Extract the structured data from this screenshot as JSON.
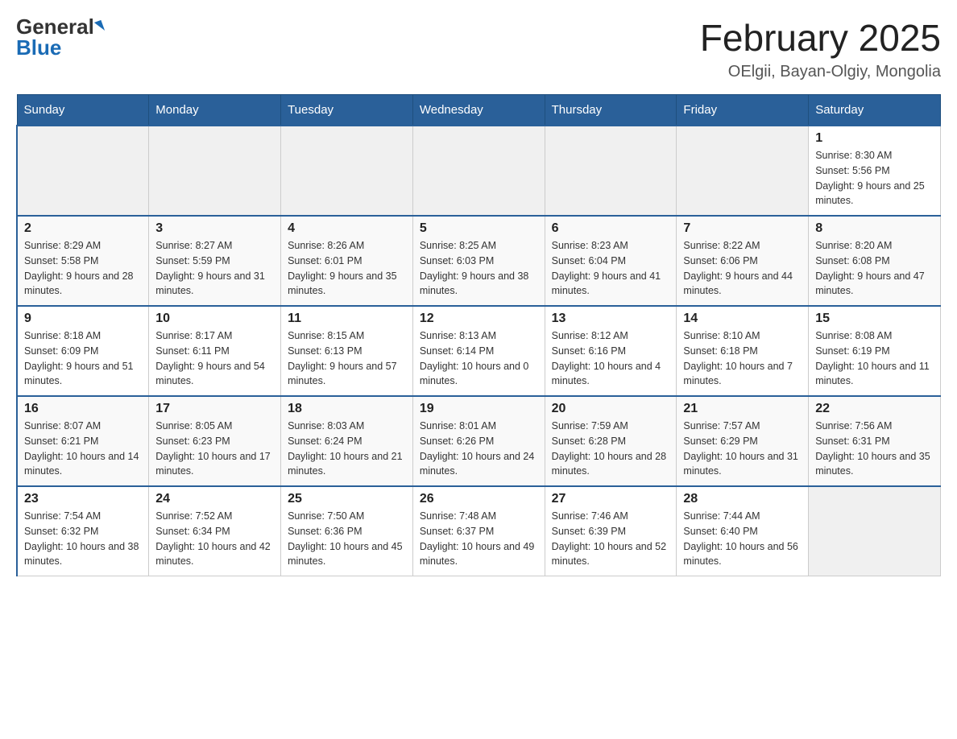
{
  "header": {
    "logo_general": "General",
    "logo_blue": "Blue",
    "title": "February 2025",
    "location": "OElgii, Bayan-Olgiy, Mongolia"
  },
  "weekdays": [
    "Sunday",
    "Monday",
    "Tuesday",
    "Wednesday",
    "Thursday",
    "Friday",
    "Saturday"
  ],
  "weeks": [
    [
      {
        "day": "",
        "info": ""
      },
      {
        "day": "",
        "info": ""
      },
      {
        "day": "",
        "info": ""
      },
      {
        "day": "",
        "info": ""
      },
      {
        "day": "",
        "info": ""
      },
      {
        "day": "",
        "info": ""
      },
      {
        "day": "1",
        "info": "Sunrise: 8:30 AM\nSunset: 5:56 PM\nDaylight: 9 hours and 25 minutes."
      }
    ],
    [
      {
        "day": "2",
        "info": "Sunrise: 8:29 AM\nSunset: 5:58 PM\nDaylight: 9 hours and 28 minutes."
      },
      {
        "day": "3",
        "info": "Sunrise: 8:27 AM\nSunset: 5:59 PM\nDaylight: 9 hours and 31 minutes."
      },
      {
        "day": "4",
        "info": "Sunrise: 8:26 AM\nSunset: 6:01 PM\nDaylight: 9 hours and 35 minutes."
      },
      {
        "day": "5",
        "info": "Sunrise: 8:25 AM\nSunset: 6:03 PM\nDaylight: 9 hours and 38 minutes."
      },
      {
        "day": "6",
        "info": "Sunrise: 8:23 AM\nSunset: 6:04 PM\nDaylight: 9 hours and 41 minutes."
      },
      {
        "day": "7",
        "info": "Sunrise: 8:22 AM\nSunset: 6:06 PM\nDaylight: 9 hours and 44 minutes."
      },
      {
        "day": "8",
        "info": "Sunrise: 8:20 AM\nSunset: 6:08 PM\nDaylight: 9 hours and 47 minutes."
      }
    ],
    [
      {
        "day": "9",
        "info": "Sunrise: 8:18 AM\nSunset: 6:09 PM\nDaylight: 9 hours and 51 minutes."
      },
      {
        "day": "10",
        "info": "Sunrise: 8:17 AM\nSunset: 6:11 PM\nDaylight: 9 hours and 54 minutes."
      },
      {
        "day": "11",
        "info": "Sunrise: 8:15 AM\nSunset: 6:13 PM\nDaylight: 9 hours and 57 minutes."
      },
      {
        "day": "12",
        "info": "Sunrise: 8:13 AM\nSunset: 6:14 PM\nDaylight: 10 hours and 0 minutes."
      },
      {
        "day": "13",
        "info": "Sunrise: 8:12 AM\nSunset: 6:16 PM\nDaylight: 10 hours and 4 minutes."
      },
      {
        "day": "14",
        "info": "Sunrise: 8:10 AM\nSunset: 6:18 PM\nDaylight: 10 hours and 7 minutes."
      },
      {
        "day": "15",
        "info": "Sunrise: 8:08 AM\nSunset: 6:19 PM\nDaylight: 10 hours and 11 minutes."
      }
    ],
    [
      {
        "day": "16",
        "info": "Sunrise: 8:07 AM\nSunset: 6:21 PM\nDaylight: 10 hours and 14 minutes."
      },
      {
        "day": "17",
        "info": "Sunrise: 8:05 AM\nSunset: 6:23 PM\nDaylight: 10 hours and 17 minutes."
      },
      {
        "day": "18",
        "info": "Sunrise: 8:03 AM\nSunset: 6:24 PM\nDaylight: 10 hours and 21 minutes."
      },
      {
        "day": "19",
        "info": "Sunrise: 8:01 AM\nSunset: 6:26 PM\nDaylight: 10 hours and 24 minutes."
      },
      {
        "day": "20",
        "info": "Sunrise: 7:59 AM\nSunset: 6:28 PM\nDaylight: 10 hours and 28 minutes."
      },
      {
        "day": "21",
        "info": "Sunrise: 7:57 AM\nSunset: 6:29 PM\nDaylight: 10 hours and 31 minutes."
      },
      {
        "day": "22",
        "info": "Sunrise: 7:56 AM\nSunset: 6:31 PM\nDaylight: 10 hours and 35 minutes."
      }
    ],
    [
      {
        "day": "23",
        "info": "Sunrise: 7:54 AM\nSunset: 6:32 PM\nDaylight: 10 hours and 38 minutes."
      },
      {
        "day": "24",
        "info": "Sunrise: 7:52 AM\nSunset: 6:34 PM\nDaylight: 10 hours and 42 minutes."
      },
      {
        "day": "25",
        "info": "Sunrise: 7:50 AM\nSunset: 6:36 PM\nDaylight: 10 hours and 45 minutes."
      },
      {
        "day": "26",
        "info": "Sunrise: 7:48 AM\nSunset: 6:37 PM\nDaylight: 10 hours and 49 minutes."
      },
      {
        "day": "27",
        "info": "Sunrise: 7:46 AM\nSunset: 6:39 PM\nDaylight: 10 hours and 52 minutes."
      },
      {
        "day": "28",
        "info": "Sunrise: 7:44 AM\nSunset: 6:40 PM\nDaylight: 10 hours and 56 minutes."
      },
      {
        "day": "",
        "info": ""
      }
    ]
  ]
}
